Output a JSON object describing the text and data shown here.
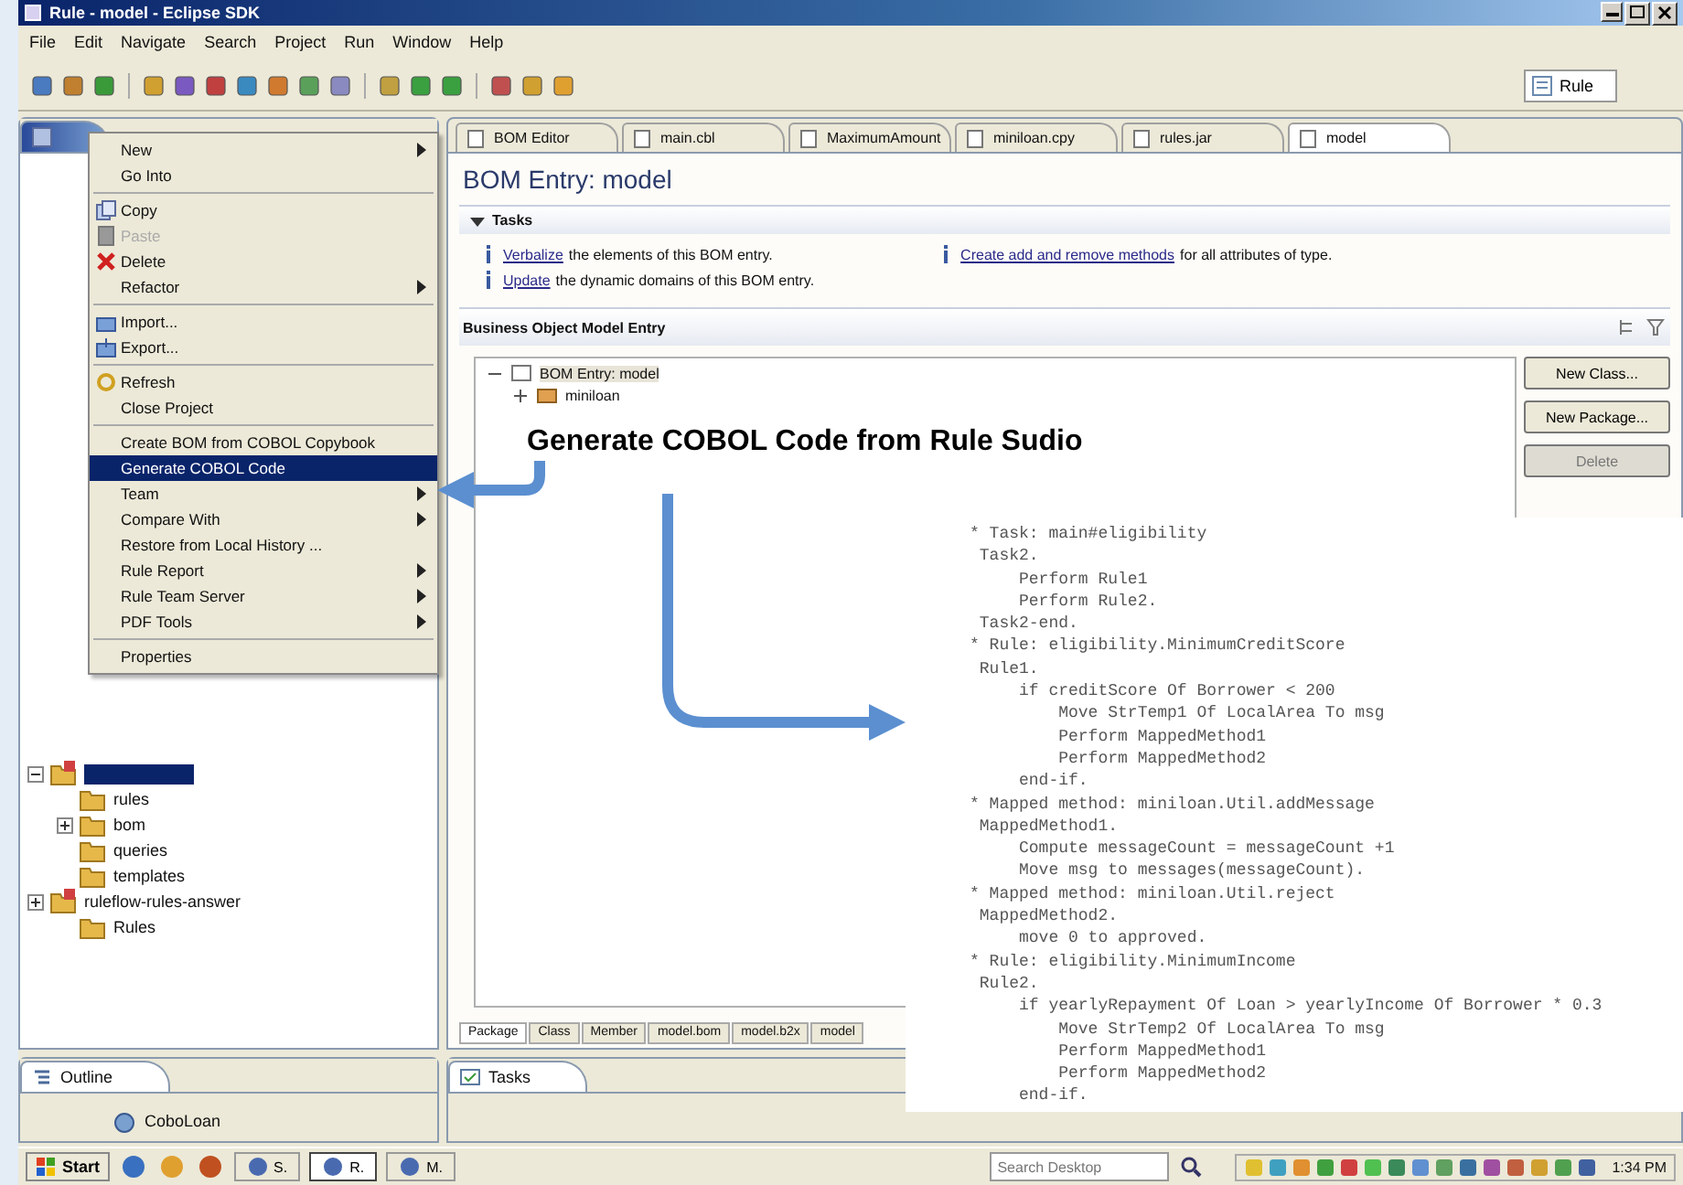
{
  "window": {
    "title": "Rule - model - Eclipse SDK"
  },
  "menu_bar": [
    "File",
    "Edit",
    "Navigate",
    "Search",
    "Project",
    "Run",
    "Window",
    "Help"
  ],
  "perspective": {
    "label": "Rule"
  },
  "explorer": {
    "tree": [
      {
        "selected": true,
        "expanded": true,
        "children": [
          {
            "label": "rules",
            "selected": false
          },
          {
            "label": "bom",
            "selected": false,
            "expanded": false
          },
          {
            "label": "queries",
            "selected": false
          },
          {
            "label": "templates",
            "selected": false
          }
        ]
      },
      {
        "label": "ruleflow-rules-answer",
        "selected": false,
        "expanded": false,
        "children": [
          {
            "label": "Rules",
            "selected": false
          }
        ]
      }
    ]
  },
  "context_menu": [
    {
      "kind": "item",
      "label": "New",
      "submenu": true,
      "disabled": false,
      "selected": false
    },
    {
      "kind": "item",
      "label": "Go Into",
      "submenu": false,
      "disabled": false,
      "selected": false
    },
    {
      "kind": "separator"
    },
    {
      "kind": "item",
      "label": "Copy",
      "submenu": false,
      "disabled": false,
      "selected": false
    },
    {
      "kind": "item",
      "label": "Paste",
      "submenu": false,
      "disabled": true,
      "selected": false
    },
    {
      "kind": "item",
      "label": "Delete",
      "submenu": false,
      "disabled": false,
      "selected": false
    },
    {
      "kind": "item",
      "label": "Refactor",
      "submenu": true,
      "disabled": false,
      "selected": false
    },
    {
      "kind": "separator"
    },
    {
      "kind": "item",
      "label": "Import...",
      "submenu": false,
      "disabled": false,
      "selected": false
    },
    {
      "kind": "item",
      "label": "Export...",
      "submenu": false,
      "disabled": false,
      "selected": false
    },
    {
      "kind": "separator"
    },
    {
      "kind": "item",
      "label": "Refresh",
      "submenu": false,
      "disabled": false,
      "selected": false
    },
    {
      "kind": "item",
      "label": "Close Project",
      "submenu": false,
      "disabled": false,
      "selected": false
    },
    {
      "kind": "separator"
    },
    {
      "kind": "item",
      "label": "Create BOM from COBOL Copybook",
      "submenu": false,
      "disabled": false,
      "selected": false
    },
    {
      "kind": "item",
      "label": "Generate COBOL Code",
      "submenu": false,
      "disabled": false,
      "selected": true
    },
    {
      "kind": "item",
      "label": "Team",
      "submenu": true,
      "disabled": false,
      "selected": false
    },
    {
      "kind": "item",
      "label": "Compare With",
      "submenu": true,
      "disabled": false,
      "selected": false
    },
    {
      "kind": "item",
      "label": "Restore from Local History ...",
      "submenu": false,
      "disabled": false,
      "selected": false
    },
    {
      "kind": "item",
      "label": "Rule Report",
      "submenu": true,
      "disabled": false,
      "selected": false
    },
    {
      "kind": "item",
      "label": "Rule Team Server",
      "submenu": true,
      "disabled": false,
      "selected": false
    },
    {
      "kind": "item",
      "label": "PDF Tools",
      "submenu": true,
      "disabled": false,
      "selected": false
    },
    {
      "kind": "separator"
    },
    {
      "kind": "item",
      "label": "Properties",
      "submenu": false,
      "disabled": false,
      "selected": false
    }
  ],
  "outline": {
    "tab": "Outline",
    "items": [
      "CoboLoan"
    ]
  },
  "editor_tabs": [
    {
      "label": "BOM Editor",
      "selected": false
    },
    {
      "label": "main.cbl",
      "selected": false
    },
    {
      "label": "MaximumAmount",
      "selected": false
    },
    {
      "label": "miniloan.cpy",
      "selected": false
    },
    {
      "label": "rules.jar",
      "selected": false
    },
    {
      "label": "model",
      "selected": true
    }
  ],
  "editor": {
    "title": "BOM Entry: model",
    "tasks_section": {
      "title": "Tasks",
      "expanded": true,
      "tasks": [
        {
          "link": "Verbalize",
          "text": "the elements of this BOM entry."
        },
        {
          "link": "Update",
          "text": "the dynamic domains of this BOM entry."
        },
        {
          "link": "Create add and remove methods",
          "text": "for all attributes of type."
        }
      ]
    },
    "bom_section": {
      "title": "Business Object Model Entry",
      "tree": [
        {
          "label": "BOM Entry: model",
          "expanded": true,
          "children": [
            {
              "label": "miniloan",
              "expanded": false
            }
          ]
        }
      ],
      "buttons": [
        {
          "label": "New Class...",
          "disabled": false
        },
        {
          "label": "New Package...",
          "disabled": false
        },
        {
          "label": "Delete",
          "disabled": true
        }
      ]
    },
    "bottom_tabs": [
      {
        "label": "Package",
        "selected": true
      },
      {
        "label": "Class",
        "selected": false
      },
      {
        "label": "Member",
        "selected": false
      },
      {
        "label": "model.bom",
        "selected": false
      },
      {
        "label": "model.b2x",
        "selected": false
      },
      {
        "label": "model",
        "selected": false
      }
    ]
  },
  "tasks_view": {
    "tab": "Tasks"
  },
  "callout": {
    "label": "Generate COBOL Code from Rule Sudio",
    "code": [
      "* Task: main#eligibility",
      " Task2.",
      "     Perform Rule1",
      "     Perform Rule2.",
      " Task2-end.",
      "* Rule: eligibility.MinimumCreditScore",
      " Rule1.",
      "     if creditScore Of Borrower < 200",
      "         Move StrTemp1 Of LocalArea To msg",
      "         Perform MappedMethod1",
      "         Perform MappedMethod2",
      "     end-if.",
      "* Mapped method: miniloan.Util.addMessage",
      " MappedMethod1.",
      "     Compute messageCount = messageCount +1",
      "     Move msg to messages(messageCount).",
      "* Mapped method: miniloan.Util.reject",
      " MappedMethod2.",
      "     move 0 to approved.",
      "* Rule: eligibility.MinimumIncome",
      " Rule2.",
      "     if yearlyRepayment Of Loan > yearlyIncome Of Borrower * 0.3",
      "         Move StrTemp2 Of LocalArea To msg",
      "         Perform MappedMethod1",
      "         Perform MappedMethod2",
      "     end-if."
    ]
  },
  "taskbar": {
    "start": "Start",
    "tasks": [
      {
        "label": "S.",
        "selected": false
      },
      {
        "label": "R.",
        "selected": true
      },
      {
        "label": "M.",
        "selected": false
      }
    ],
    "search": {
      "placeholder": "Search Desktop"
    },
    "clock": "1:34 PM"
  }
}
